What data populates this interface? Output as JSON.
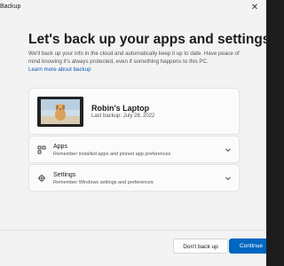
{
  "window": {
    "title": "Backup"
  },
  "header": {
    "title": "Let's back up your apps and settings",
    "subtitle": "We'll back up your info in the cloud and automatically keep it up to date. Have peace of mind knowing it's always protected, even if something happens to this PC.",
    "learn_more": "Learn more about backup"
  },
  "device": {
    "name": "Robin's Laptop",
    "last_backup": "Last backup: July 28, 2022"
  },
  "options": [
    {
      "title": "Apps",
      "description": "Remember installed apps and pinned app preferences",
      "icon": "apps-grid-icon"
    },
    {
      "title": "Settings",
      "description": "Remember Windows settings and preferences",
      "icon": "gear-icon"
    }
  ],
  "footer": {
    "secondary_label": "Don't back up",
    "primary_label": "Continue"
  },
  "colors": {
    "accent": "#0067c0",
    "link": "#0a5cb8",
    "background": "#f3f3f3"
  }
}
